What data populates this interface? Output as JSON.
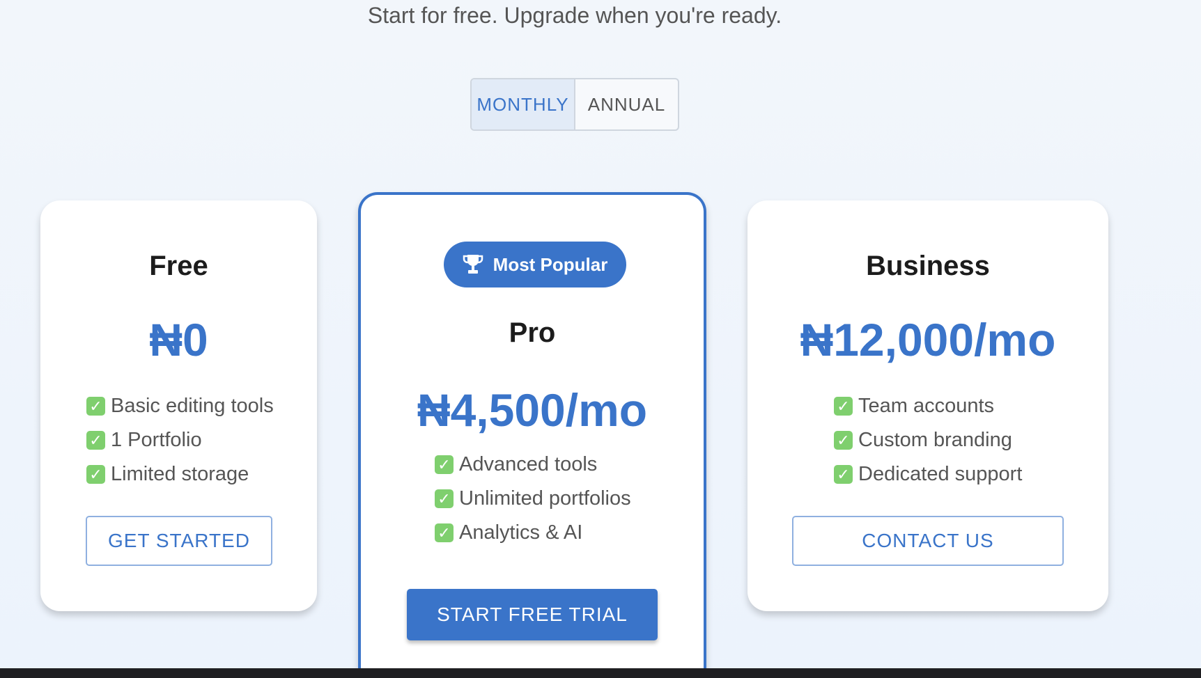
{
  "header": {
    "subtitle": "Start for free. Upgrade when you're ready."
  },
  "billing_toggle": {
    "options": [
      "MONTHLY",
      "ANNUAL"
    ],
    "selected": "MONTHLY"
  },
  "plans": [
    {
      "name": "Free",
      "price": "₦0",
      "features": [
        "Basic editing tools",
        "1 Portfolio",
        "Limited storage"
      ],
      "cta": "GET STARTED"
    },
    {
      "name": "Pro",
      "badge": "Most Popular",
      "price": "₦4,500/mo",
      "features": [
        "Advanced tools",
        "Unlimited portfolios",
        "Analytics & AI"
      ],
      "cta": "START FREE TRIAL"
    },
    {
      "name": "Business",
      "price": "₦12,000/mo",
      "features": [
        "Team accounts",
        "Custom branding",
        "Dedicated support"
      ],
      "cta": "CONTACT US"
    }
  ],
  "colors": {
    "accent": "#3a74c9",
    "check": "#7fcf6e",
    "background": "#f2f6fb"
  },
  "icons": {
    "badge": "trophy-icon",
    "feature": "checkmark-icon"
  }
}
